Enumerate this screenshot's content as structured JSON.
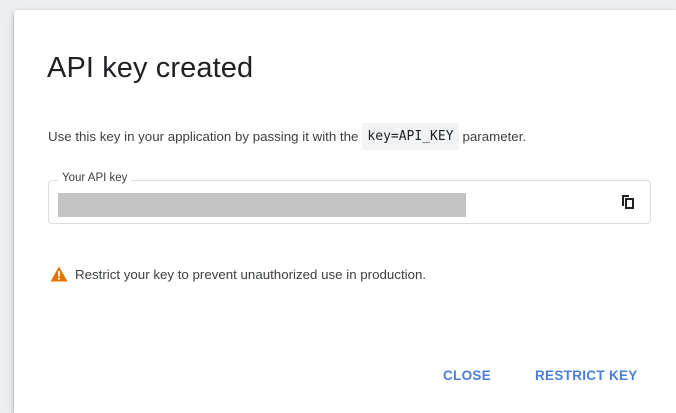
{
  "dialog": {
    "title": "API key created",
    "description_before": "Use this key in your application by passing it with the",
    "description_code": "key=API_KEY",
    "description_after": "parameter.",
    "field": {
      "label": "Your API key",
      "value": "",
      "copy_icon": "copy-icon"
    },
    "warning": {
      "icon": "warning-triangle-icon",
      "text": "Restrict your key to prevent unauthorized use in production."
    },
    "actions": {
      "close_label": "CLOSE",
      "restrict_label": "RESTRICT KEY"
    }
  },
  "colors": {
    "accent": "#4a7fd9",
    "warning": "#e37400",
    "text": "#3c4043",
    "title": "#202124",
    "redacted": "#c4c4c4"
  }
}
